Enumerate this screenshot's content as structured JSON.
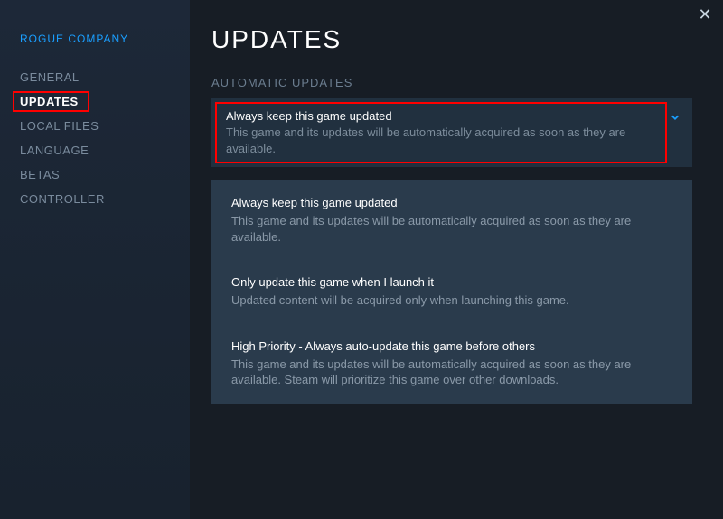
{
  "sidebar": {
    "game_title": "ROGUE COMPANY",
    "items": [
      {
        "label": "GENERAL"
      },
      {
        "label": "UPDATES"
      },
      {
        "label": "LOCAL FILES"
      },
      {
        "label": "LANGUAGE"
      },
      {
        "label": "BETAS"
      },
      {
        "label": "CONTROLLER"
      }
    ]
  },
  "page": {
    "title": "UPDATES",
    "section_label": "AUTOMATIC UPDATES"
  },
  "selected_option": {
    "title": "Always keep this game updated",
    "desc": "This game and its updates will be automatically acquired as soon as they are available."
  },
  "options": [
    {
      "title": "Always keep this game updated",
      "desc": "This game and its updates will be automatically acquired as soon as they are available."
    },
    {
      "title": "Only update this game when I launch it",
      "desc": "Updated content will be acquired only when launching this game."
    },
    {
      "title": "High Priority - Always auto-update this game before others",
      "desc": "This game and its updates will be automatically acquired as soon as they are available. Steam will prioritize this game over other downloads."
    }
  ]
}
